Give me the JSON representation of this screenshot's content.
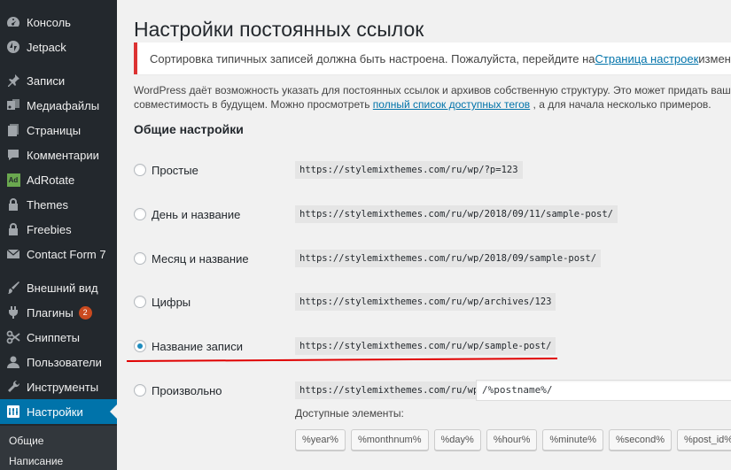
{
  "sidebar": {
    "items": [
      {
        "label": "Консоль",
        "icon": "dashboard-icon"
      },
      {
        "label": "Jetpack",
        "icon": "jetpack-icon"
      },
      {
        "label": "Записи",
        "icon": "pin-icon"
      },
      {
        "label": "Медиафайлы",
        "icon": "media-icon"
      },
      {
        "label": "Страницы",
        "icon": "pages-icon"
      },
      {
        "label": "Комментарии",
        "icon": "comment-icon"
      },
      {
        "label": "AdRotate",
        "icon": "adrotate-icon",
        "icon_text": "Ad"
      },
      {
        "label": "Themes",
        "icon": "lock-icon"
      },
      {
        "label": "Freebies",
        "icon": "lock-icon"
      },
      {
        "label": "Contact Form 7",
        "icon": "mail-icon"
      },
      {
        "label": "Внешний вид",
        "icon": "brush-icon"
      },
      {
        "label": "Плагины",
        "icon": "plugin-icon",
        "badge": "2"
      },
      {
        "label": "Сниппеты",
        "icon": "scissors-icon"
      },
      {
        "label": "Пользователи",
        "icon": "user-icon"
      },
      {
        "label": "Инструменты",
        "icon": "wrench-icon"
      },
      {
        "label": "Настройки",
        "icon": "settings-icon",
        "active": true
      }
    ],
    "submenu": [
      {
        "label": "Общие"
      },
      {
        "label": "Написание"
      }
    ]
  },
  "page": {
    "title": "Настройки постоянных ссылок",
    "notice": {
      "before": "Сортировка типичных записей должна быть настроена. Пожалуйста, перейдите на ",
      "link": "Страница настроек",
      "after": " изменить конфигурацию"
    },
    "description": {
      "line1": "WordPress даёт возможность указать для постоянных ссылок и архивов собственную структуру. Это может придать вашим ссылкам эсте",
      "line2_before": "совместимость в будущем. Можно просмотреть ",
      "line2_link": "полный список доступных тегов",
      "line2_after": ", а для начала несколько примеров."
    },
    "section_title": "Общие настройки",
    "options": [
      {
        "label": "Простые",
        "example": "https://stylemixthemes.com/ru/wp/?p=123",
        "checked": false
      },
      {
        "label": "День и название",
        "example": "https://stylemixthemes.com/ru/wp/2018/09/11/sample-post/",
        "checked": false
      },
      {
        "label": "Месяц и название",
        "example": "https://stylemixthemes.com/ru/wp/2018/09/sample-post/",
        "checked": false
      },
      {
        "label": "Цифры",
        "example": "https://stylemixthemes.com/ru/wp/archives/123",
        "checked": false
      },
      {
        "label": "Название записи",
        "example": "https://stylemixthemes.com/ru/wp/sample-post/",
        "checked": true
      },
      {
        "label": "Произвольно",
        "example": "https://stylemixthemes.com/ru/wp",
        "checked": false
      }
    ],
    "custom_structure_value": "/%postname%/",
    "available_label": "Доступные элементы:",
    "tags": [
      "%year%",
      "%monthnum%",
      "%day%",
      "%hour%",
      "%minute%",
      "%second%",
      "%post_id%"
    ]
  },
  "colors": {
    "sidebar_bg": "#23282d",
    "active_bg": "#0073aa",
    "notice_border": "#dc3232",
    "annotation_line": "#e00000"
  }
}
